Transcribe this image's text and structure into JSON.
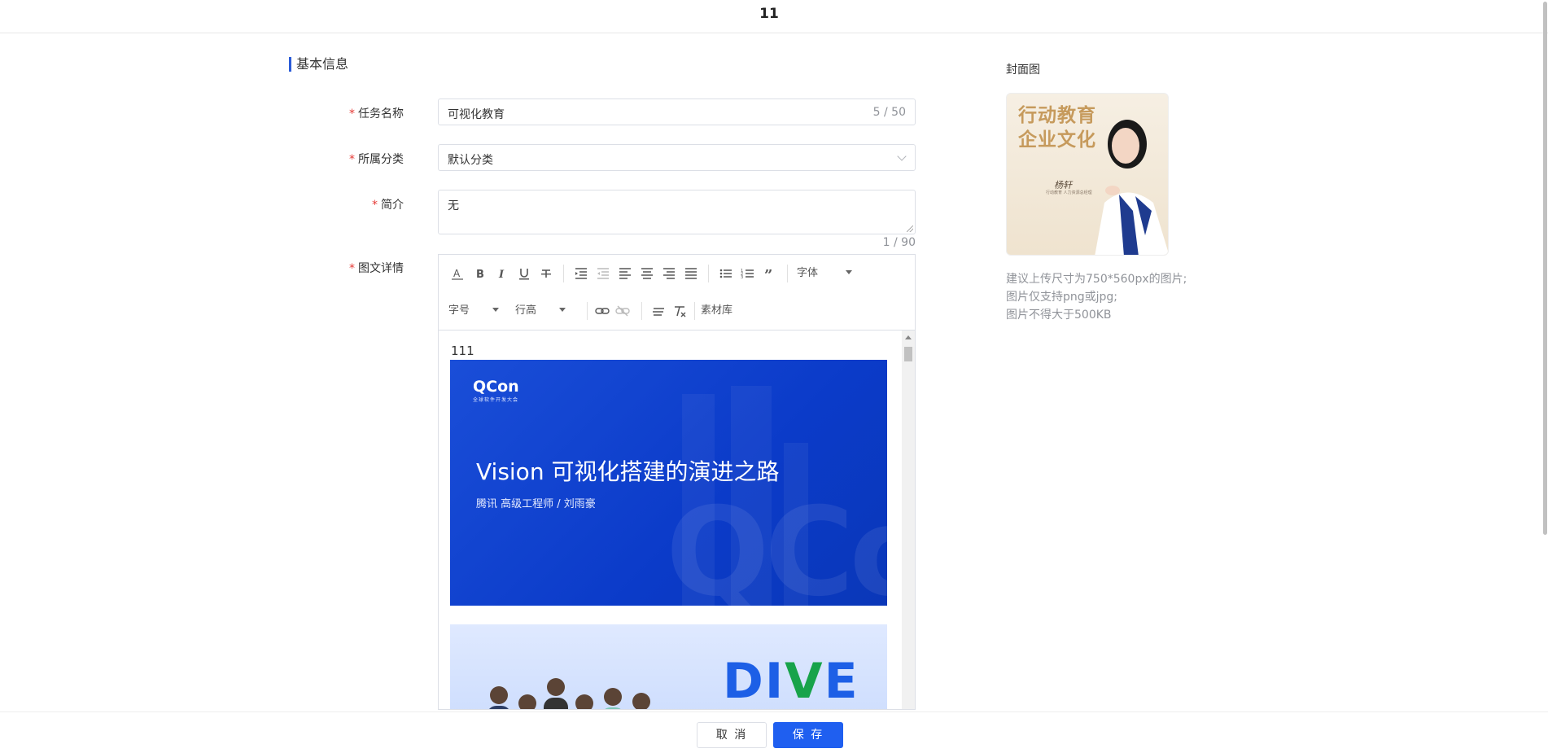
{
  "header": {
    "title": "11"
  },
  "section": {
    "title": "基本信息"
  },
  "form": {
    "required_mark": "*",
    "task_name": {
      "label": "任务名称",
      "value": "可视化教育",
      "counter": "5 / 50"
    },
    "category": {
      "label": "所属分类",
      "value": "默认分类"
    },
    "intro": {
      "label": "简介",
      "value": "无",
      "counter": "1 / 90"
    },
    "detail": {
      "label": "图文详情"
    }
  },
  "editor": {
    "toolbar": {
      "font_family": "字体",
      "font_size": "字号",
      "line_height": "行高",
      "material_library": "素材库"
    },
    "content": {
      "text": "111",
      "slide1": {
        "logo": "QCon",
        "logo_sub": "全球软件开发大会",
        "title": "Vision 可视化搭建的演进之路",
        "subtitle": "腾讯 高级工程师 / 刘雨豪",
        "watermark": "QCo"
      },
      "slide2": {
        "brand": "DIVE"
      }
    }
  },
  "cover": {
    "label": "封面图",
    "line1": "行动教育",
    "line2": "企业文化",
    "signature": "杨轩",
    "signature_sub": "行动教育 人力资源总经理"
  },
  "hints": [
    "建议上传尺寸为750*560px的图片;",
    "图片仅支持png或jpg;",
    "图片不得大于500KB"
  ],
  "footer": {
    "cancel": "取 消",
    "save": "保 存"
  },
  "colors": {
    "primary": "#1f5ff0",
    "required": "#e53935",
    "slide_blue": "#0b3bc9"
  }
}
